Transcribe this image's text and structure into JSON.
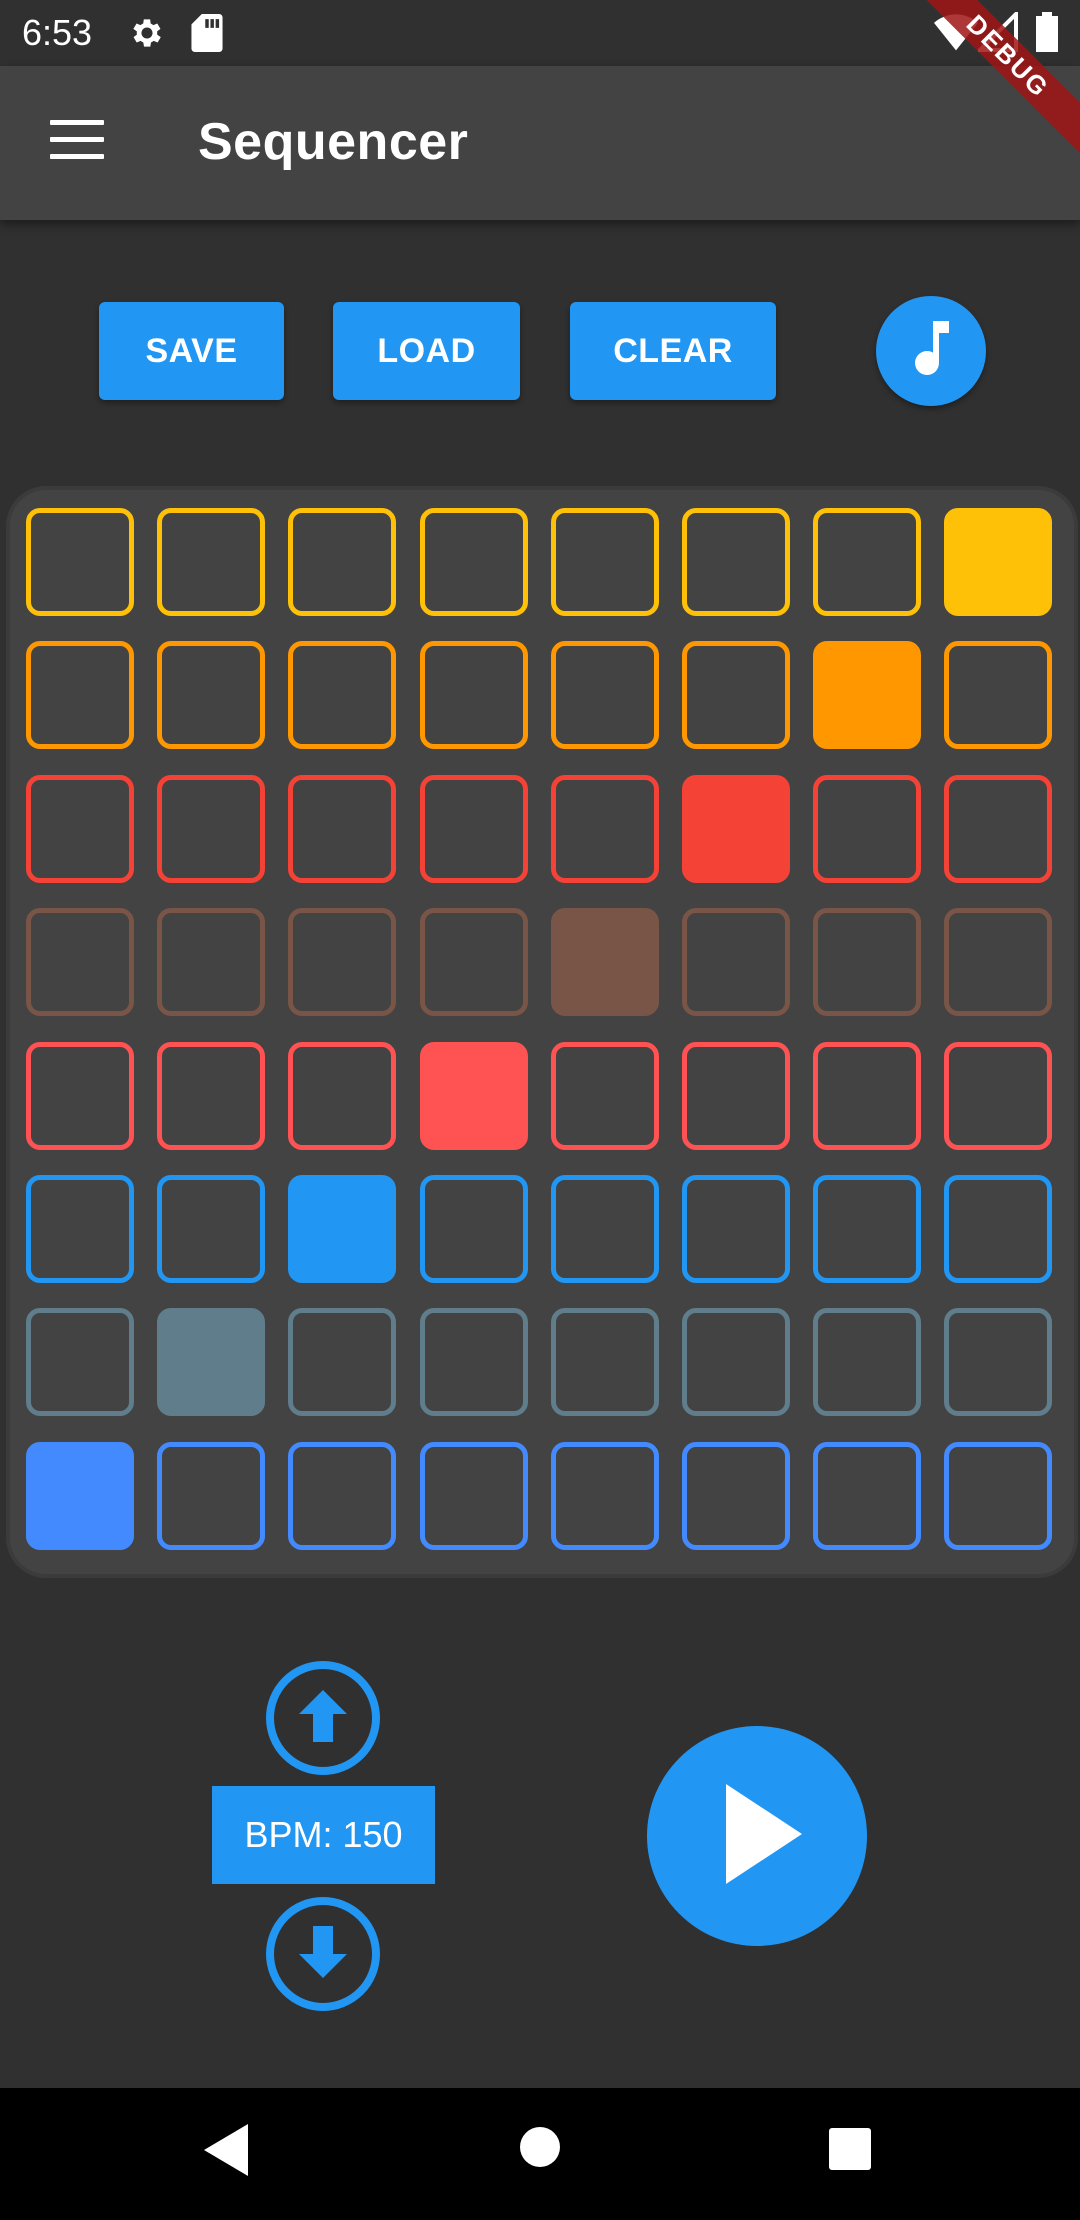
{
  "status_bar": {
    "time": "6:53",
    "icons": [
      "settings-icon",
      "sd-card-icon",
      "wifi-icon",
      "signal-icon",
      "battery-icon"
    ]
  },
  "debug_banner": "DEBUG",
  "app_bar": {
    "title": "Sequencer",
    "menu_icon": "menu-icon"
  },
  "toolbar": {
    "save_label": "SAVE",
    "load_label": "LOAD",
    "clear_label": "CLEAR",
    "music_icon": "music-note-icon"
  },
  "grid": {
    "rows": [
      {
        "color": "#ffc107",
        "active_step": 7
      },
      {
        "color": "#ff9800",
        "active_step": 6
      },
      {
        "color": "#f44336",
        "active_step": 5
      },
      {
        "color": "#795548",
        "active_step": 4
      },
      {
        "color": "#ff5252",
        "active_step": 3
      },
      {
        "color": "#2196f3",
        "active_step": 2
      },
      {
        "color": "#607d8b",
        "active_step": 1
      },
      {
        "color": "#448aff",
        "active_step": 0
      }
    ],
    "steps": 8
  },
  "bpm": {
    "label": "BPM: 150",
    "up_icon": "arrow-up-icon",
    "down_icon": "arrow-down-icon"
  },
  "play_icon": "play-icon",
  "colors": {
    "accent": "#2196f3",
    "background": "#303030",
    "appbar": "#434343",
    "grid_bg": "#434343"
  },
  "nav_bar": {
    "icons": [
      "back-icon",
      "home-icon",
      "recents-icon"
    ]
  }
}
